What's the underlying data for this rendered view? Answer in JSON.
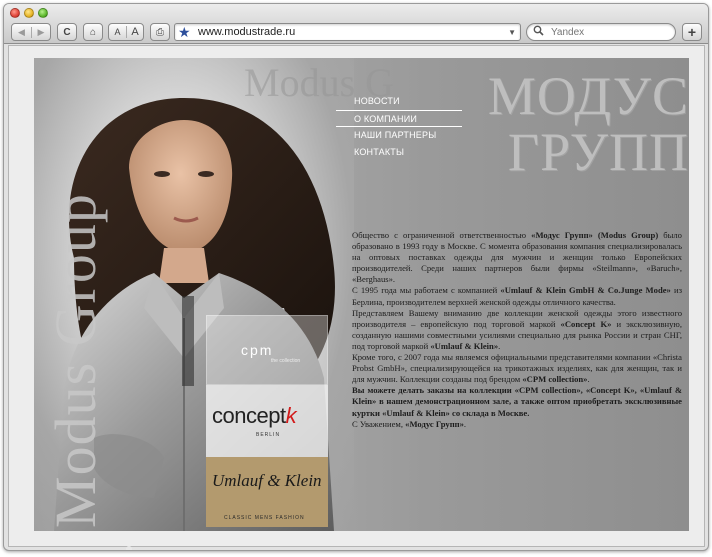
{
  "browser": {
    "back_label": "◀",
    "forward_label": "▶",
    "reload_label": "C",
    "home_label": "⌂",
    "text_small_label": "A",
    "text_large_label": "A",
    "print_label": "⎙",
    "add_label": "+",
    "url": "www.modustrade.ru",
    "url_dropdown_label": "▼",
    "search_icon": "Q",
    "search_placeholder": "Yandex"
  },
  "site": {
    "title_line1": "МОДУС",
    "title_line2": "ГРУПП",
    "ghost_text": "Modus G",
    "vertical_logo": "Modus Group",
    "menu": [
      {
        "label": "НОВОСТИ"
      },
      {
        "label": "О КОМПАНИИ"
      },
      {
        "label": "НАШИ ПАРТНЕРЫ"
      },
      {
        "label": "КОНТАКТЫ"
      }
    ],
    "brands": {
      "cpm": "cpm",
      "cpm_sub": "the collection",
      "concept": "concept",
      "concept_k": "k",
      "concept_berlin": "BERLIN",
      "umlauf": "Umlauf & Klein",
      "umlauf_sub": "CLASSIC MENS FASHION"
    },
    "paragraphs": [
      {
        "parts": [
          "Общество с ограниченной ответственностью ",
          {
            "b": "«Модус Групп» (Modus Group)"
          },
          " было образовано в 1993 году в Москве. С момента образования компания специализировалась на оптовых поставках одежды для мужчин и женщин только Европейских производителей. Среди наших партнеров были фирмы «Steilmann», «Baruch», «Berghaus»."
        ]
      },
      {
        "parts": [
          "С 1995 года мы работаем с компанией ",
          {
            "b": "«Umlauf & Klein GmbH & Co.Junge Mode»"
          },
          " из Берлина, производителем верхней женской одежды отличного качества."
        ]
      },
      {
        "parts": [
          "Представляем Вашему вниманию две коллекции женской одежды этого известного производителя – европейскую под торговой маркой ",
          {
            "b": "«Concept K»"
          },
          " и эксклюзивную, созданную нашими совместными усилиями специально для рынка России и стран СНГ, под торговой маркой ",
          {
            "b": "«Umlauf & Klein»"
          },
          "."
        ]
      },
      {
        "parts": [
          "Кроме того, с 2007 года мы являемся официальными представителями компании «Christa Probst GmbH», специализирующейся на трикотажных изделиях, как для женщин, так и для мужчин. Коллекции созданы под брендом ",
          {
            "b": "«CPM collection»"
          },
          "."
        ]
      },
      {
        "parts": [
          {
            "b": "Вы можете делать заказы на коллекции «CPM collection», «Concept K», «Umlauf & Klein» в нашем демонстрационном зале, а также оптом приобретать эксклюзивные куртки «Umlauf & Klein» со склада в Москве."
          }
        ]
      },
      {
        "parts": [
          "С Уважением,   ",
          {
            "b": "«Модус Групп»"
          },
          "."
        ]
      }
    ]
  }
}
